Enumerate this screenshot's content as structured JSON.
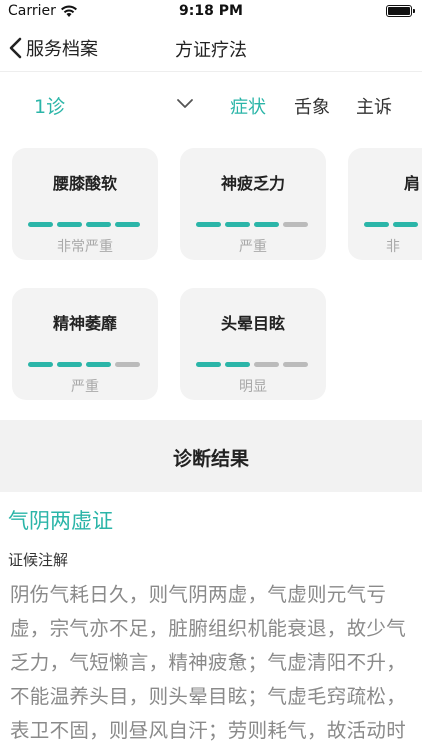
{
  "status": {
    "carrier": "Carrier",
    "time": "9:18 PM"
  },
  "nav": {
    "back_label": "服务档案",
    "title": "方证疗法"
  },
  "visit": {
    "label": "1诊"
  },
  "tabs": [
    {
      "label": "症状",
      "active": true
    },
    {
      "label": "舌象",
      "active": false
    },
    {
      "label": "主诉",
      "active": false
    }
  ],
  "symptoms": [
    {
      "name": "腰膝酸软",
      "level": "非常严重",
      "filled": 4,
      "total": 4
    },
    {
      "name": "神疲乏力",
      "level": "严重",
      "filled": 3,
      "total": 4
    },
    {
      "name": "肩",
      "level": "非",
      "filled": 4,
      "total": 4
    },
    {
      "name": "精神萎靡",
      "level": "严重",
      "filled": 3,
      "total": 4
    },
    {
      "name": "头晕目眩",
      "level": "明显",
      "filled": 2,
      "total": 4
    }
  ],
  "diagnosis": {
    "heading": "诊断结果",
    "syndrome": "气阴两虚证",
    "explain_title": "证候注解",
    "explain_text": "阴伤气耗日久，则气阴两虚，气虚则元气亏虚，宗气亦不足，脏腑组织机能衰退，故少气乏力，气短懒言，精神疲惫；气虚清阳不升，不能温养头目，则头晕目眩；气虚毛窍疏松，表卫不固，则昼风自汗；劳则耗气，故活动时诸症"
  },
  "colors": {
    "accent": "#2bb5a8",
    "bar_off": "#bbbbbb",
    "card_bg": "#f3f3f3"
  }
}
